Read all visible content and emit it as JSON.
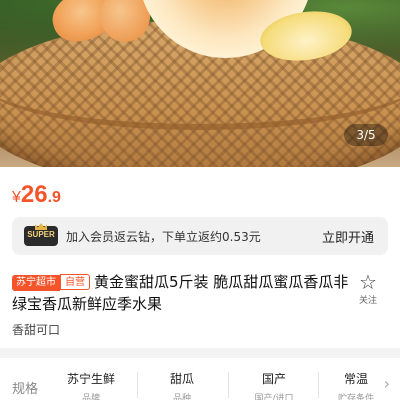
{
  "gallery": {
    "counter": "3/5"
  },
  "price": {
    "currency": "¥",
    "integer": "26",
    "decimal": ".9"
  },
  "super_bar": {
    "badge": "SUPER",
    "text": "加入会员返云钻，下单立返约0.53元",
    "action": "立即开通"
  },
  "product": {
    "tags": [
      "苏宁超市",
      "自营"
    ],
    "title": "黄金蜜甜瓜5斤装 脆瓜甜瓜蜜瓜香瓜非绿宝香瓜新鲜应季水果",
    "subtitle": "香甜可口",
    "follow_label": "关注"
  },
  "specs": {
    "label": "规格",
    "items": [
      {
        "value": "苏宁生鲜",
        "key": "品牌"
      },
      {
        "value": "甜瓜",
        "key": "品种"
      },
      {
        "value": "国产",
        "key": "国产/进口"
      },
      {
        "value": "常温",
        "key": "贮存条件"
      }
    ]
  },
  "colors": {
    "accent": "#f5542a",
    "badge_bg": "#2b2b2b",
    "badge_text": "#f4d27c"
  }
}
